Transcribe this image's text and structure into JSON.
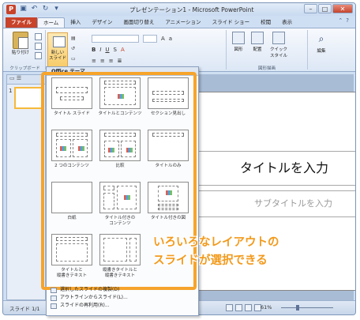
{
  "window": {
    "title": "プレゼンテーション1 - Microsoft PowerPoint",
    "controls": [
      "–",
      "□",
      "✕"
    ]
  },
  "tabs": [
    "ファイル",
    "ホーム",
    "挿入",
    "デザイン",
    "画面切り替え",
    "アニメーション",
    "スライド ショー",
    "校閲",
    "表示"
  ],
  "ribbon": {
    "paste_label": "貼り付け",
    "clipboard_group": "クリップボード",
    "new_slide_label": "新しい\nスライド",
    "drawing_group": "図形描画",
    "shapes_label": "図形",
    "arrange_label": "配置",
    "quick_style_label": "クイック\nスタイル",
    "edit_label": "編集"
  },
  "gallery": {
    "header": "Office テーマ",
    "layouts": [
      {
        "name": "タイトル スライド"
      },
      {
        "name": "タイトルとコンテンツ"
      },
      {
        "name": "セクション見出し"
      },
      {
        "name": "2 つのコンテンツ"
      },
      {
        "name": "比較"
      },
      {
        "name": "タイトルのみ"
      },
      {
        "name": "白紙"
      },
      {
        "name": "タイトル付きの\nコンテンツ"
      },
      {
        "name": "タイトル付きの図"
      },
      {
        "name": "タイトルと\n縦書きテキスト"
      },
      {
        "name": "縦書きタイトルと\n縦書きテキスト"
      }
    ],
    "menu": [
      "選択したスライドの複製(D)",
      "アウトラインからスライド(L)...",
      "スライドの再利用(R)..."
    ]
  },
  "slide": {
    "thumb_number": "1",
    "title_placeholder": "タイトルを入力",
    "subtitle_placeholder": "サブタイトルを入力"
  },
  "status": {
    "slide_indicator": "スライド 1/1",
    "zoom": "61%",
    "zoom_level_percent": 61
  },
  "annotation": {
    "line1": "いろいろなレイアウトの",
    "line2": "スライドが選択できる"
  },
  "colors": {
    "file_tab": "#c8432a",
    "highlight": "#f6a42c",
    "annotation": "#f29a1c"
  }
}
